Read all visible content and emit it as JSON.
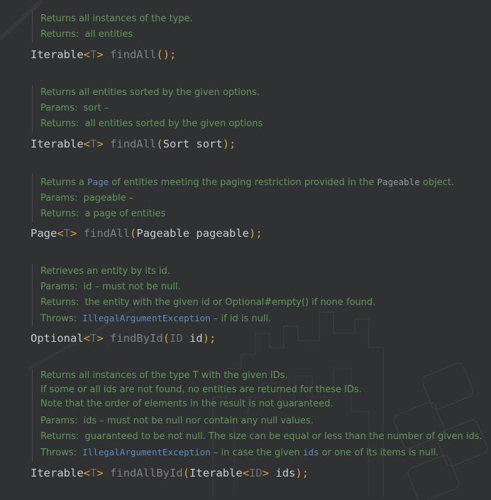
{
  "colors": {
    "background": "#303132",
    "doc_text": "#62975a",
    "code_ref": "#5d8fc0",
    "type_param": "#d9a13f"
  },
  "blocks": [
    {
      "doc": {
        "summary": "Returns all instances of the type.",
        "returns_key": "Returns:",
        "returns": "all entities"
      },
      "sig": {
        "ret": "Iterable",
        "lt": "<",
        "tp": "T",
        "gt": ">",
        "name": "findAll",
        "open": "(",
        "close": ")",
        "semi": ";"
      }
    },
    {
      "doc": {
        "summary": "Returns all entities sorted by the given options.",
        "params_key": "Params:",
        "params": "sort –",
        "returns_key": "Returns:",
        "returns": "all entities sorted by the given options"
      },
      "sig": {
        "ret": "Iterable",
        "lt": "<",
        "tp": "T",
        "gt": ">",
        "name": "findAll",
        "open": "(",
        "args": "Sort sort",
        "close": ")",
        "semi": ";"
      }
    },
    {
      "doc": {
        "summary_a": "Returns a",
        "summary_ref1": "Page",
        "summary_b": "of entities meeting the paging restriction provided in the",
        "summary_ref2": "Pageable",
        "summary_c": "object.",
        "params_key": "Params:",
        "params": "pageable –",
        "returns_key": "Returns:",
        "returns": "a page of entities"
      },
      "sig": {
        "ret": "Page",
        "lt": "<",
        "tp": "T",
        "gt": ">",
        "name": "findAll",
        "open": "(",
        "args": "Pageable pageable",
        "close": ")",
        "semi": ";"
      }
    },
    {
      "doc": {
        "summary": "Retrieves an entity by its id.",
        "params_key": "Params:",
        "params": "id – must not be null.",
        "returns_key": "Returns:",
        "returns": "the entity with the given id or Optional#empty() if none found.",
        "throws_key": "Throws:",
        "throws_ref": "IllegalArgumentException",
        "throws": "– if id is null."
      },
      "sig": {
        "ret": "Optional",
        "lt": "<",
        "tp": "T",
        "gt": ">",
        "name": "findById",
        "open": "(",
        "arg_type": "ID",
        "arg_name": "id",
        "close": ")",
        "semi": ";"
      }
    },
    {
      "doc": {
        "summary_1": "Returns all instances of the type T with the given IDs.",
        "summary_2": "If some or all ids are not found, no entities are returned for these IDs.",
        "summary_3": "Note that the order of elements in the result is not guaranteed.",
        "params_key": "Params:",
        "params": "ids – must not be null nor contain any null values.",
        "returns_key": "Returns:",
        "returns": "guaranteed to be not null. The size can be equal or less than the number of given ids.",
        "throws_key": "Throws:",
        "throws_ref": "IllegalArgumentException",
        "throws_a": "– in case the given",
        "throws_ref2": "ids",
        "throws_b": "or one of its items is null."
      },
      "sig": {
        "ret": "Iterable",
        "lt": "<",
        "tp": "T",
        "gt": ">",
        "name": "findAllById",
        "open": "(",
        "arg_type": "Iterable",
        "arg_lt": "<",
        "arg_tp": "ID",
        "arg_gt": ">",
        "arg_name": "ids",
        "close": ")",
        "semi": ";"
      }
    }
  ]
}
